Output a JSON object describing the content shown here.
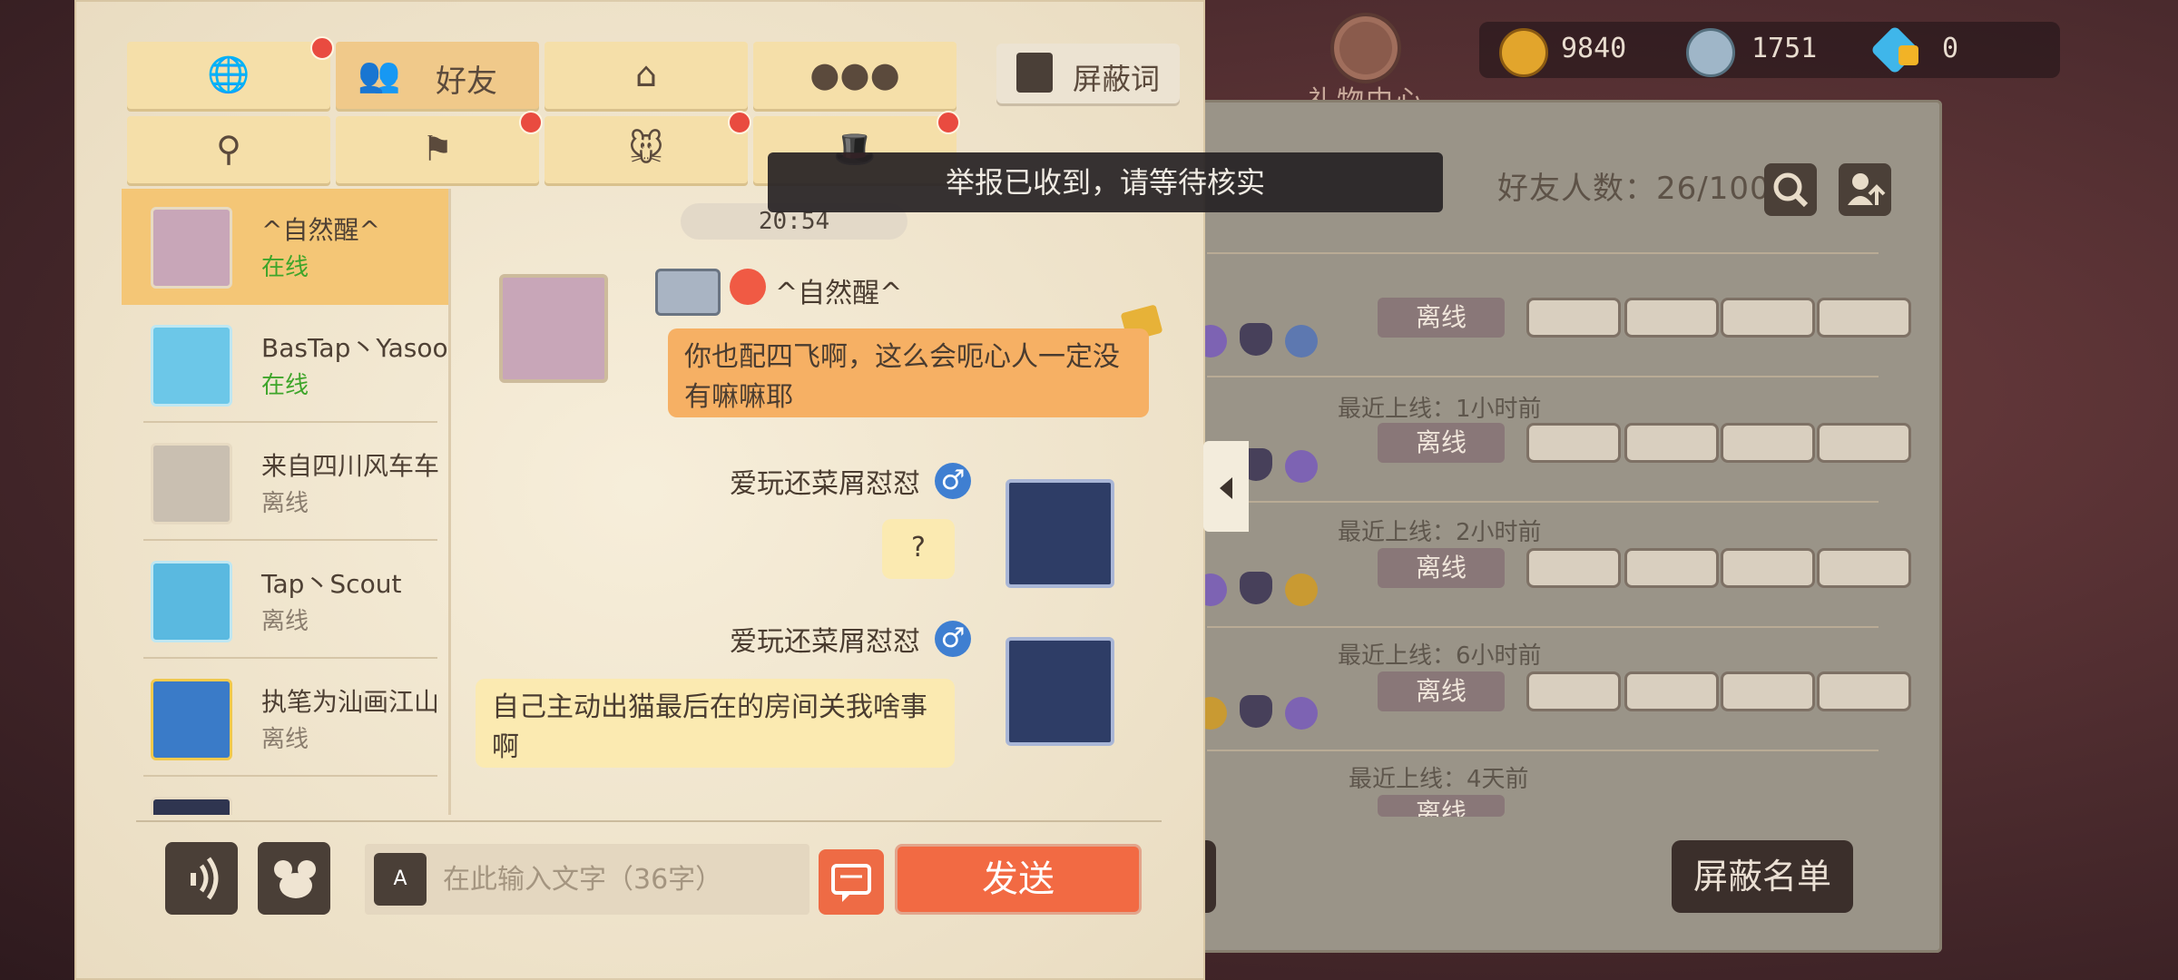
{
  "top_bar": {
    "gift_center_label": "礼物中心",
    "gold": "9840",
    "silver": "1751",
    "diamond": "0"
  },
  "tabs": {
    "friends_label": "好友",
    "block_words_label": "屏蔽词"
  },
  "toast": "举报已收到，请等待核实",
  "friends_panel": {
    "friend_count": "好友人数：26/100",
    "offline": "离线",
    "rows_last_online": [
      "最近上线：1小时前",
      "最近上线：2小时前",
      "最近上线：6小时前",
      "最近上线：4天前"
    ],
    "block_list_label": "屏蔽名单"
  },
  "contacts": [
    {
      "name": "^自然醒^",
      "status": "在线"
    },
    {
      "name": "BasTap丶Yasoo",
      "status": "在线"
    },
    {
      "name": "来自四川风车车",
      "status": "离线"
    },
    {
      "name": "Tap丶Scout",
      "status": "离线"
    },
    {
      "name": "执笔为汕画江山",
      "status": "离线"
    }
  ],
  "chat": {
    "timestamp": "20:54",
    "messages": [
      {
        "sender": "^自然醒^",
        "text": "你也配四飞啊，这么会呃心人一定没有嘛嘛耶"
      },
      {
        "sender": "爱玩还菜屑怼怼",
        "text": "?"
      },
      {
        "sender": "爱玩还菜屑怼怼",
        "text": "自己主动出猫最后在的房间关我啥事啊"
      }
    ]
  },
  "input": {
    "placeholder": "在此输入文字（36字）",
    "send_label": "发送"
  },
  "colors": {
    "online": "#4bb32d",
    "offline": "#8a7d6e",
    "accent": "#f26a43"
  }
}
